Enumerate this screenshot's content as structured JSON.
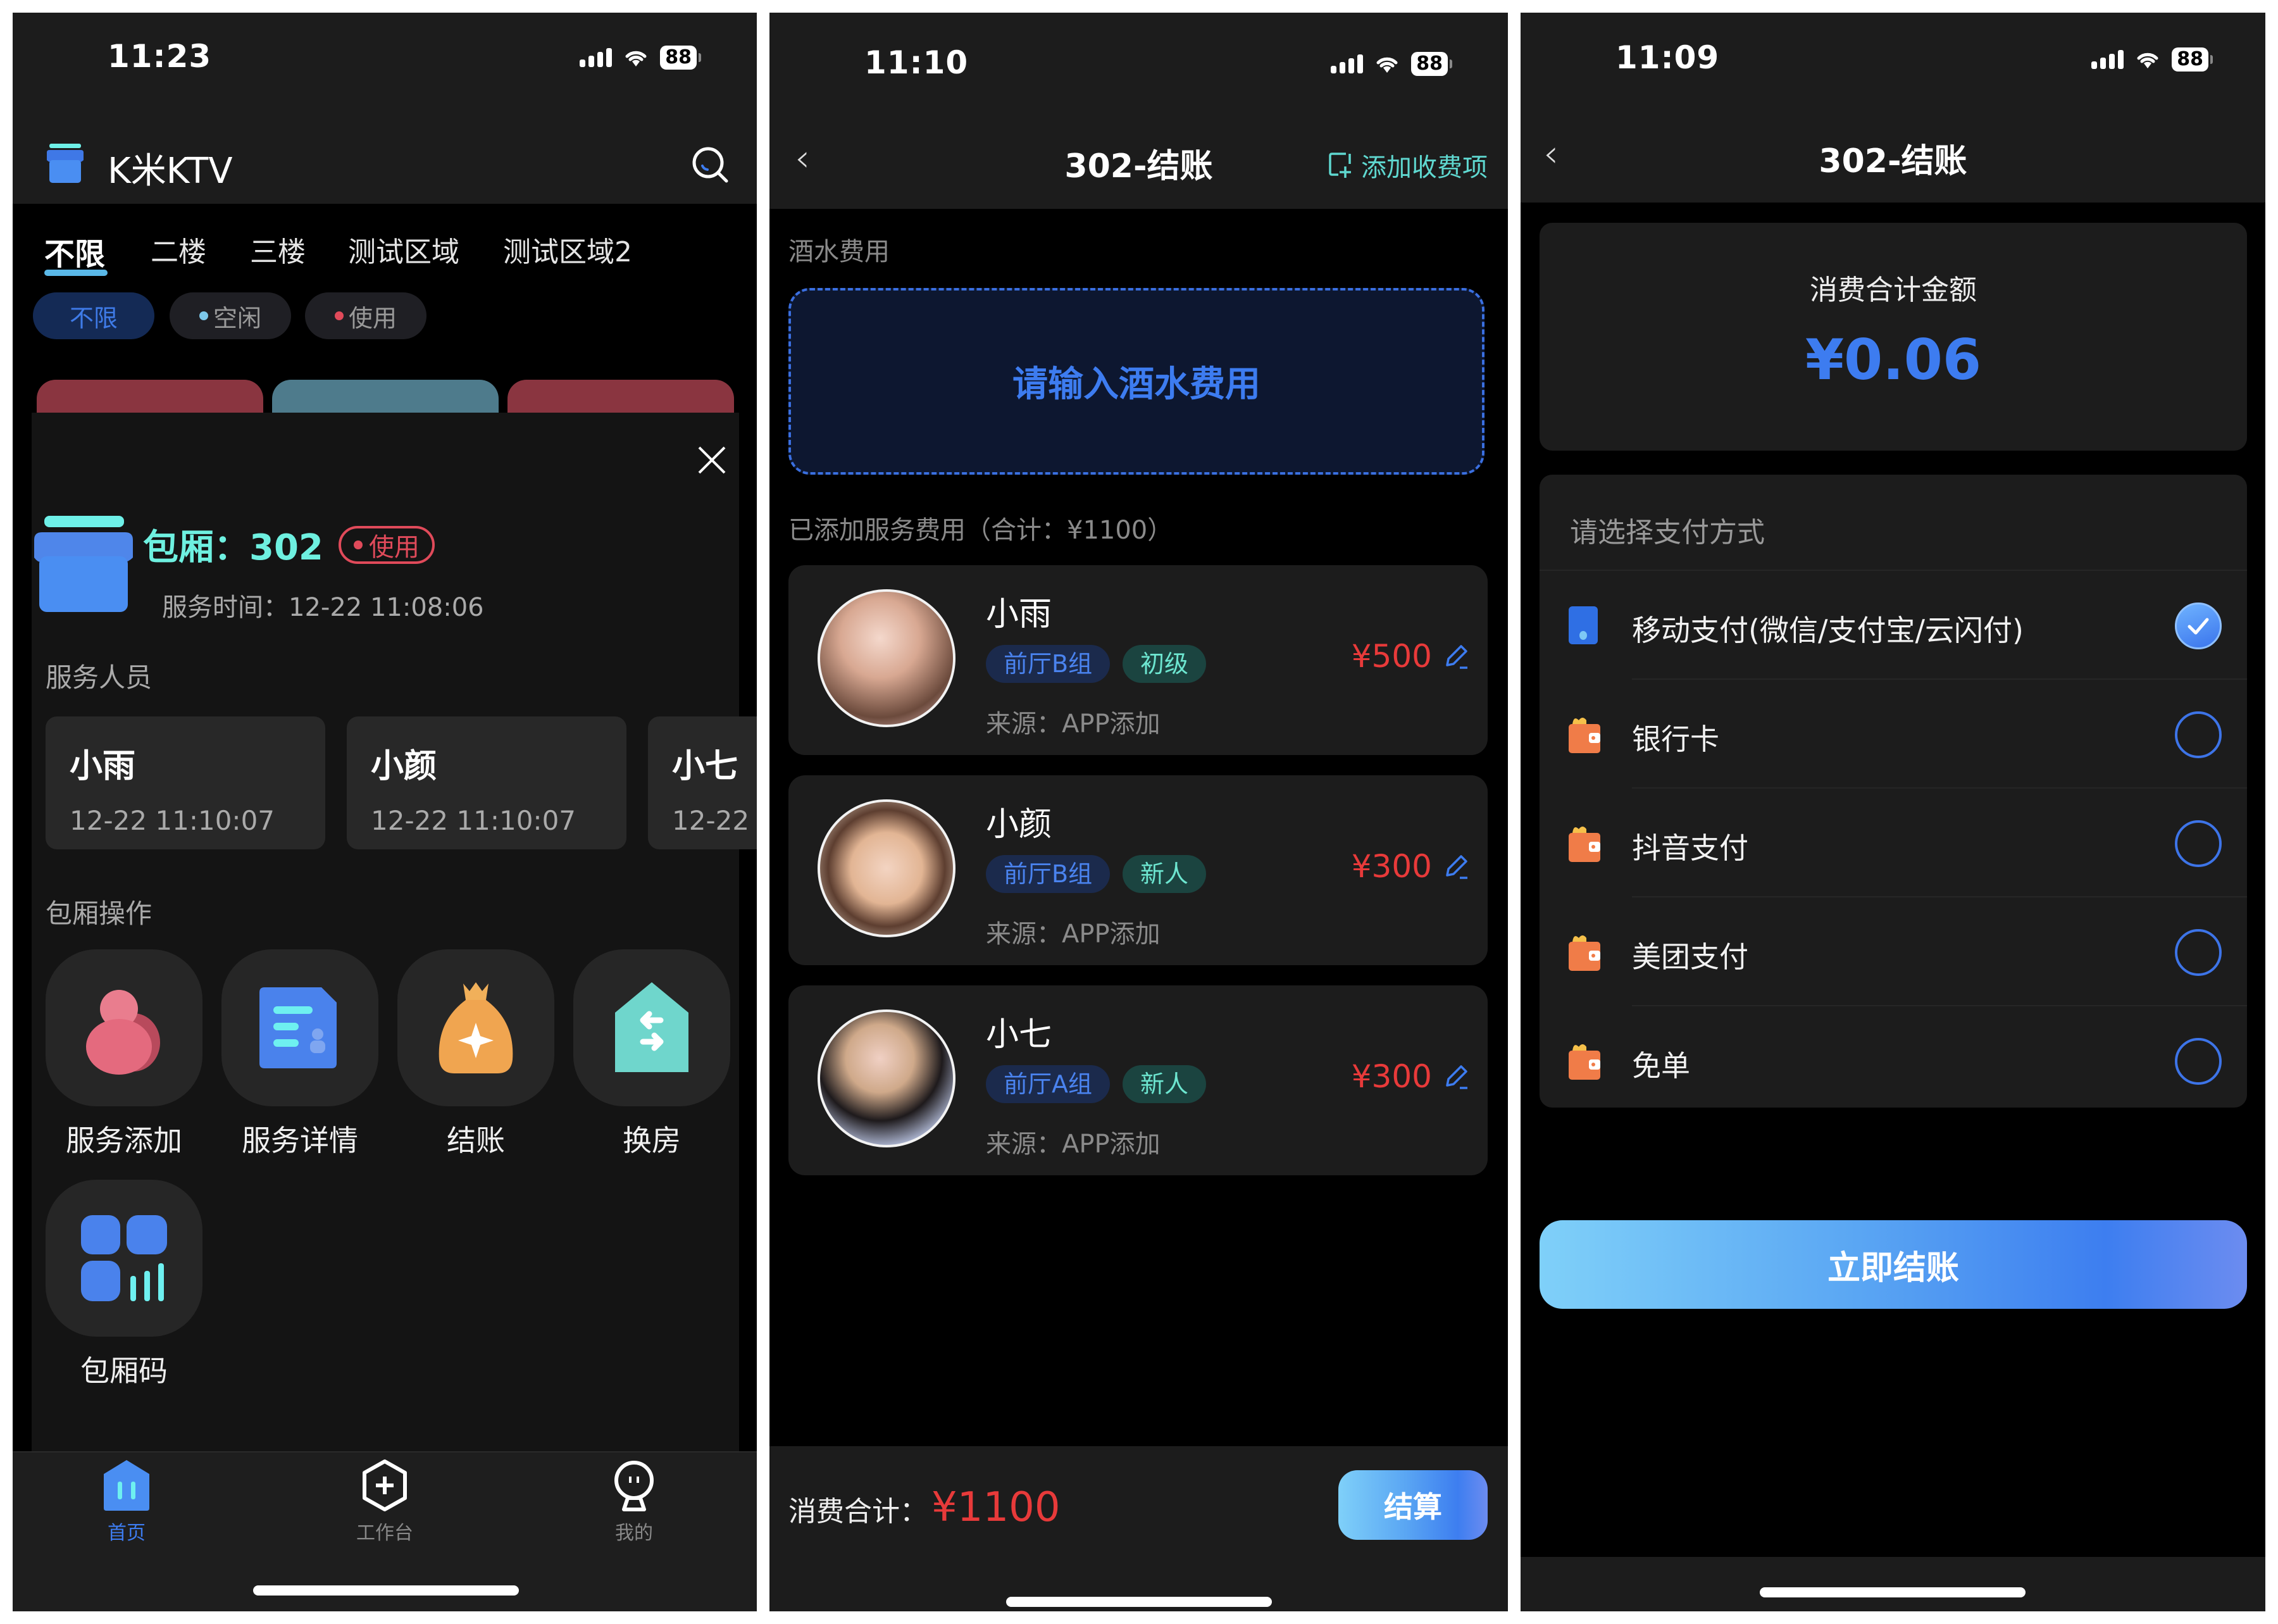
{
  "status_bar": {
    "panel1_time": "11:23",
    "panel2_time": "11:10",
    "panel3_time": "11:09",
    "battery": "88"
  },
  "home": {
    "app_name": "K米KTV",
    "search_icon": "search-icon",
    "area_tabs": [
      {
        "label": "不限",
        "active": true
      },
      {
        "label": "二楼",
        "active": false
      },
      {
        "label": "三楼",
        "active": false
      },
      {
        "label": "测试区域",
        "active": false
      },
      {
        "label": "测试区域2",
        "active": false
      }
    ],
    "status_filters": [
      {
        "label": "不限",
        "active": true,
        "dot_color": ""
      },
      {
        "label": "空闲",
        "active": false,
        "dot_color": "#7cc8ea"
      },
      {
        "label": "使用",
        "active": false,
        "dot_color": "#e04a5a"
      }
    ],
    "room_card_colors": [
      "#8a3540",
      "#4e7b8c",
      "#8a3540"
    ],
    "room_sheet": {
      "close_icon": "close-icon",
      "room_label": "包厢：302",
      "status_badge": "使用",
      "service_time": "服务时间：12-22 11:08:06",
      "staff_section_title": "服务人员",
      "staff": [
        {
          "name": "小雨",
          "time": "12-22 11:10:07"
        },
        {
          "name": "小颜",
          "time": "12-22 11:10:07"
        },
        {
          "name": "小七",
          "time": "12-22"
        }
      ],
      "ops_section_title": "包厢操作",
      "operations": [
        {
          "label": "服务添加",
          "icon": "person-add-icon"
        },
        {
          "label": "服务详情",
          "icon": "document-detail-icon"
        },
        {
          "label": "结账",
          "icon": "money-bag-icon"
        },
        {
          "label": "换房",
          "icon": "swap-room-icon"
        },
        {
          "label": "包厢码",
          "icon": "room-code-icon"
        }
      ]
    },
    "tab_bar": [
      {
        "label": "首页",
        "active": true
      },
      {
        "label": "工作台",
        "active": false
      },
      {
        "label": "我的",
        "active": false
      }
    ]
  },
  "checkout": {
    "title": "302-结账",
    "add_fee_label": "添加收费项",
    "drink_section_title": "酒水费用",
    "drink_input_placeholder": "请输入酒水费用",
    "service_section_title": "已添加服务费用（合计：¥1100）",
    "services": [
      {
        "name": "小雨",
        "group": "前厅B组",
        "level": "初级",
        "source": "来源：APP添加",
        "price": "¥500"
      },
      {
        "name": "小颜",
        "group": "前厅B组",
        "level": "新人",
        "source": "来源：APP添加",
        "price": "¥300"
      },
      {
        "name": "小七",
        "group": "前厅A组",
        "level": "新人",
        "source": "来源：APP添加",
        "price": "¥300"
      }
    ],
    "total_label": "消费合计：",
    "total_value": "¥1100",
    "settle_button": "结算"
  },
  "payment": {
    "title": "302-结账",
    "amount_label": "消费合计金额",
    "amount_value": "¥0.06",
    "method_section_title": "请选择支付方式",
    "methods": [
      {
        "label": "移动支付(微信/支付宝/云闪付)",
        "selected": true,
        "icon": "phone-icon"
      },
      {
        "label": "银行卡",
        "selected": false,
        "icon": "wallet-icon"
      },
      {
        "label": "抖音支付",
        "selected": false,
        "icon": "wallet-icon"
      },
      {
        "label": "美团支付",
        "selected": false,
        "icon": "wallet-icon"
      },
      {
        "label": "免单",
        "selected": false,
        "icon": "wallet-icon"
      }
    ],
    "pay_button": "立即结账"
  },
  "colors": {
    "accent_blue": "#3d7cf0",
    "accent_cyan": "#6de6d0",
    "price_red": "#e83a3a",
    "panel_bg": "#000000",
    "card_bg": "#1c1c1c"
  }
}
